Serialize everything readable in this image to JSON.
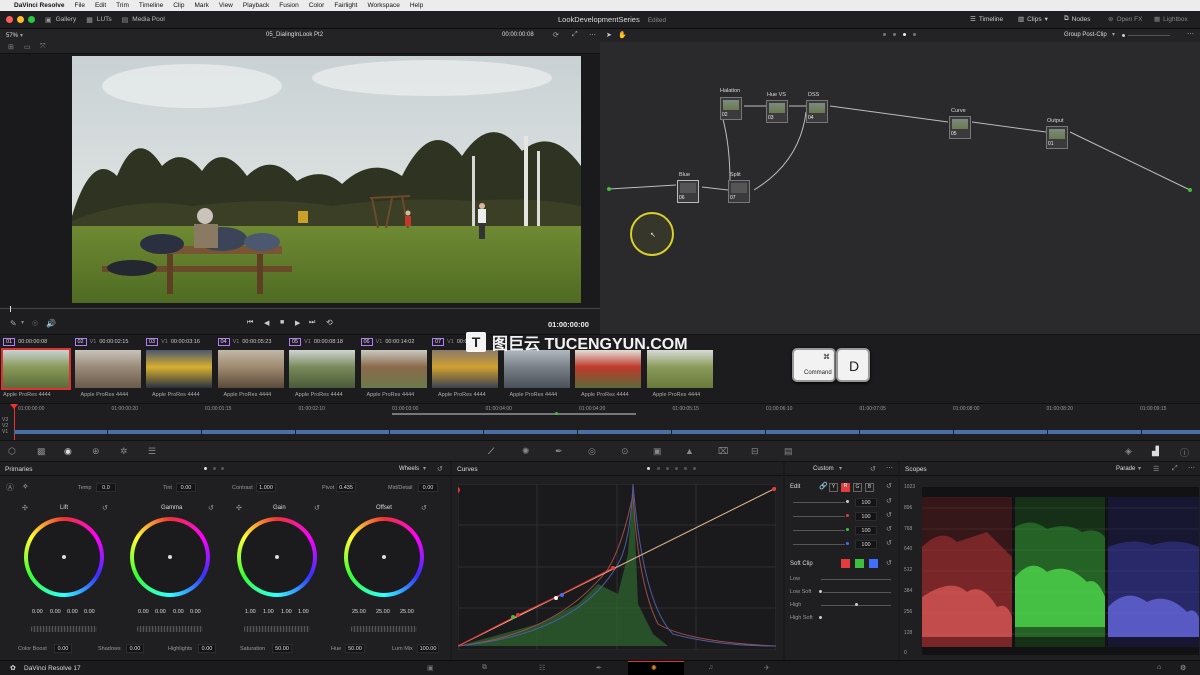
{
  "menubar": {
    "app": "DaVinci Resolve",
    "items": [
      "File",
      "Edit",
      "Trim",
      "Timeline",
      "Clip",
      "Mark",
      "View",
      "Playback",
      "Fusion",
      "Color",
      "Fairlight",
      "Workspace",
      "Help"
    ]
  },
  "toolbar": {
    "gallery": "Gallery",
    "luts": "LUTs",
    "media_pool": "Media Pool",
    "project_title": "LookDevelopmentSeries",
    "project_status": "Edited",
    "timeline": "Timeline",
    "clips": "Clips",
    "nodes": "Nodes",
    "openfx": "Open FX",
    "lightbox": "Lightbox"
  },
  "viewer": {
    "zoom": "57%",
    "clip_name": "05_DialingInLook Pt2",
    "timecode_top": "00:00:00:08",
    "timecode_transport": "01:00:00:00"
  },
  "node_editor": {
    "mode": "Group Post-Clip",
    "nodes": [
      {
        "label": "Halation",
        "num": "02"
      },
      {
        "label": "Hue VS",
        "num": "03"
      },
      {
        "label": "DSS",
        "num": "04"
      },
      {
        "label": "Curve",
        "num": "05"
      },
      {
        "label": "Output",
        "num": "01"
      },
      {
        "label": "Blue",
        "num": "06"
      },
      {
        "label": "Split",
        "num": "07"
      }
    ]
  },
  "clips": [
    {
      "idx": "01",
      "track": "",
      "tc": "00:00:00:08",
      "codec": "Apple ProRes 4444"
    },
    {
      "idx": "02",
      "track": "V1",
      "tc": "00:00:02:15",
      "codec": "Apple ProRes 4444"
    },
    {
      "idx": "03",
      "track": "V1",
      "tc": "00:00:03:16",
      "codec": "Apple ProRes 4444"
    },
    {
      "idx": "04",
      "track": "V1",
      "tc": "00:00:05:23",
      "codec": "Apple ProRes 4444"
    },
    {
      "idx": "05",
      "track": "V1",
      "tc": "00:00:08:18",
      "codec": "Apple ProRes 4444"
    },
    {
      "idx": "06",
      "track": "V1",
      "tc": "00:00:14:02",
      "codec": "Apple ProRes 4444"
    },
    {
      "idx": "07",
      "track": "V1",
      "tc": "00:00",
      "codec": "Apple ProRes 4444"
    },
    {
      "idx": "",
      "track": "",
      "tc": "",
      "codec": "Apple ProRes 4444"
    },
    {
      "idx": "",
      "track": "",
      "tc": "",
      "codec": "Apple ProRes 4444"
    },
    {
      "idx": "",
      "track": "",
      "tc": "",
      "codec": "Apple ProRes 4444"
    }
  ],
  "timeline": {
    "ticks": [
      "01:00:00:00",
      "01:00:00:20",
      "01:00:01:15",
      "01:00:02:10",
      "01:00:03:00",
      "01:00:04:00",
      "01:00:04:20",
      "01:00:05:15",
      "01:00:06:10",
      "01:00:07:05",
      "01:00:08:00",
      "01:00:08:20",
      "01:00:09:15"
    ],
    "tracks": [
      "V3",
      "V2",
      "V1"
    ]
  },
  "primaries": {
    "title": "Primaries",
    "mode": "Wheels",
    "temp_label": "Temp",
    "temp": "0.0",
    "tint_label": "Tint",
    "tint": "0.00",
    "contrast_label": "Contrast",
    "contrast": "1.000",
    "pivot_label": "Pivot",
    "pivot": "0.435",
    "middetail_label": "Mid/Detail",
    "middetail": "0.00",
    "wheels": [
      {
        "name": "Lift",
        "values": [
          "0.00",
          "0.00",
          "0.00",
          "0.00"
        ]
      },
      {
        "name": "Gamma",
        "values": [
          "0.00",
          "0.00",
          "0.00",
          "0.00"
        ]
      },
      {
        "name": "Gain",
        "values": [
          "1.00",
          "1.00",
          "1.00",
          "1.00"
        ]
      },
      {
        "name": "Offset",
        "values": [
          "25.00",
          "25.00",
          "25.00"
        ]
      }
    ],
    "colorboost_label": "Color Boost",
    "colorboost": "0.00",
    "shadows_label": "Shadows",
    "shadows": "0.00",
    "highlights_label": "Highlights",
    "highlights": "0.00",
    "saturation_label": "Saturation",
    "saturation": "50.00",
    "hue_label": "Hue",
    "hue": "50.00",
    "lummix_label": "Lum Mix",
    "lummix": "100.00"
  },
  "curves": {
    "title": "Curves"
  },
  "custom": {
    "title": "Custom",
    "edit": "Edit",
    "channels": [
      "Y",
      "R",
      "G",
      "B"
    ],
    "edit_values": [
      "100",
      "100",
      "100",
      "100"
    ],
    "softclip": "Soft Clip",
    "softclip_rows": [
      "Low",
      "Low Soft",
      "High",
      "High Soft"
    ]
  },
  "scopes": {
    "title": "Scopes",
    "mode": "Parade",
    "ticks": [
      "1023",
      "896",
      "768",
      "640",
      "512",
      "384",
      "256",
      "128",
      "0"
    ]
  },
  "statusbar": {
    "app": "DaVinci Resolve 17"
  },
  "overlay": {
    "watermark": "图巨云 TUCENGYUN.COM",
    "key_command": "Command",
    "key_command_glyph": "⌘",
    "key_d": "D"
  },
  "colors": {
    "accent_red": "#e23c3c",
    "accent_green": "#3fbf3f",
    "accent_blue": "#3f6fff",
    "accent_purple": "#b57cff"
  }
}
